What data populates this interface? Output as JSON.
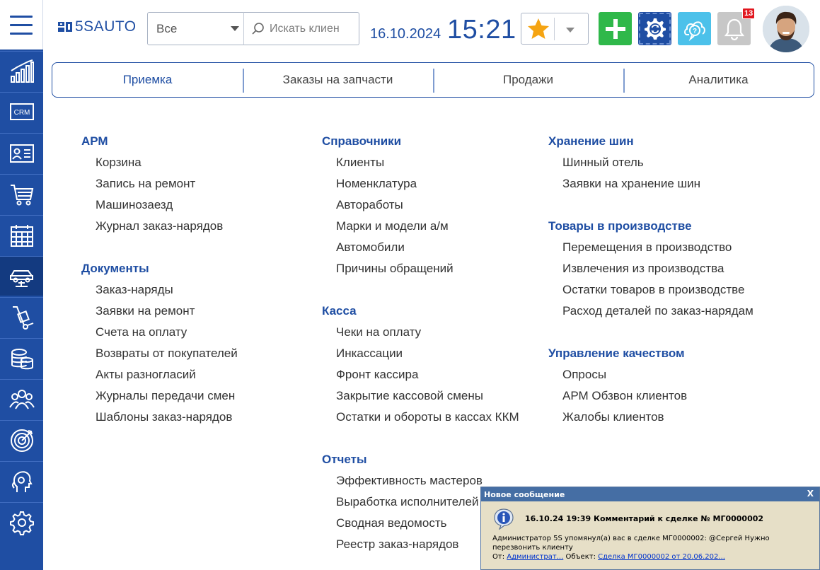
{
  "header": {
    "logo_text": "5SAUTO",
    "scope_select": "Все",
    "search_placeholder": "Искать клиен",
    "date": "16.10.2024",
    "time": "15:21",
    "notification_count": "13"
  },
  "colors": {
    "brand": "#1f4ea3",
    "sidebar": "#1f4ea3",
    "sidebar_active": "#133a80",
    "add_button": "#2fb84a",
    "help_button": "#4cc1ea",
    "bell_button": "#c7c7c7",
    "badge": "#e1161e",
    "star": "#f5a412"
  },
  "sidebar": {
    "items": [
      {
        "icon": "chart-icon"
      },
      {
        "icon": "crm-icon",
        "text": "CRM"
      },
      {
        "icon": "id-card-icon"
      },
      {
        "icon": "cart-icon"
      },
      {
        "icon": "calendar-icon"
      },
      {
        "icon": "car-lift-icon",
        "active": true
      },
      {
        "icon": "hand-truck-icon"
      },
      {
        "icon": "coins-icon"
      },
      {
        "icon": "team-icon"
      },
      {
        "icon": "target-icon"
      },
      {
        "icon": "head-support-icon"
      },
      {
        "icon": "gear-icon"
      }
    ]
  },
  "tabs": [
    {
      "label": "Приемка",
      "active": true
    },
    {
      "label": "Заказы на запчасти"
    },
    {
      "label": "Продажи"
    },
    {
      "label": "Аналитика"
    }
  ],
  "menu": {
    "col1": [
      {
        "title": "АРМ",
        "items": [
          "Корзина",
          "Запись на ремонт",
          "Машинозаезд",
          "Журнал заказ-нарядов"
        ]
      },
      {
        "title": "Документы",
        "items": [
          "Заказ-наряды",
          "Заявки на ремонт",
          "Счета на оплату",
          "Возвраты от покупателей",
          "Акты разногласий",
          "Журналы передачи смен",
          "Шаблоны заказ-нарядов"
        ]
      }
    ],
    "col2": [
      {
        "title": "Справочники",
        "items": [
          "Клиенты",
          "Номенклатура",
          "Автоработы",
          "Марки и модели а/м",
          "Автомобили",
          "Причины обращений"
        ]
      },
      {
        "title": "Касса",
        "items": [
          "Чеки на оплату",
          "Инкассации",
          "Фронт кассира",
          "Закрытие кассовой смены",
          "Остатки и обороты в кассах ККМ"
        ]
      },
      {
        "title": "Отчеты",
        "items": [
          "Эффективность мастеров",
          "Выработка исполнителей",
          "Сводная ведомость",
          "Реестр заказ-нарядов"
        ]
      }
    ],
    "col3": [
      {
        "title": "Хранение шин",
        "items": [
          "Шинный отель",
          "Заявки на хранение шин"
        ]
      },
      {
        "title": "Товары в производстве",
        "items": [
          "Перемещения в производство",
          "Извлечения из производства",
          "Остатки товаров в производстве",
          "Расход деталей по заказ-нарядам"
        ]
      },
      {
        "title": "Управление качеством",
        "items": [
          "Опросы",
          "АРМ Обзвон клиентов",
          "Жалобы клиентов"
        ]
      }
    ]
  },
  "popup": {
    "header": "Новое сообщение",
    "close": "X",
    "title": "16.10.24 19:39 Комментарий к сделке № МГ0000002",
    "body": "Администратор 5S упомянул(а) вас в сделке МГ0000002: @Сергей Нужно перезвонить клиенту",
    "from_label": "От:",
    "from_link": "Администрат...",
    "object_label": "Объект:",
    "object_link": "Сделка МГ0000002 от 20.06.202..."
  }
}
